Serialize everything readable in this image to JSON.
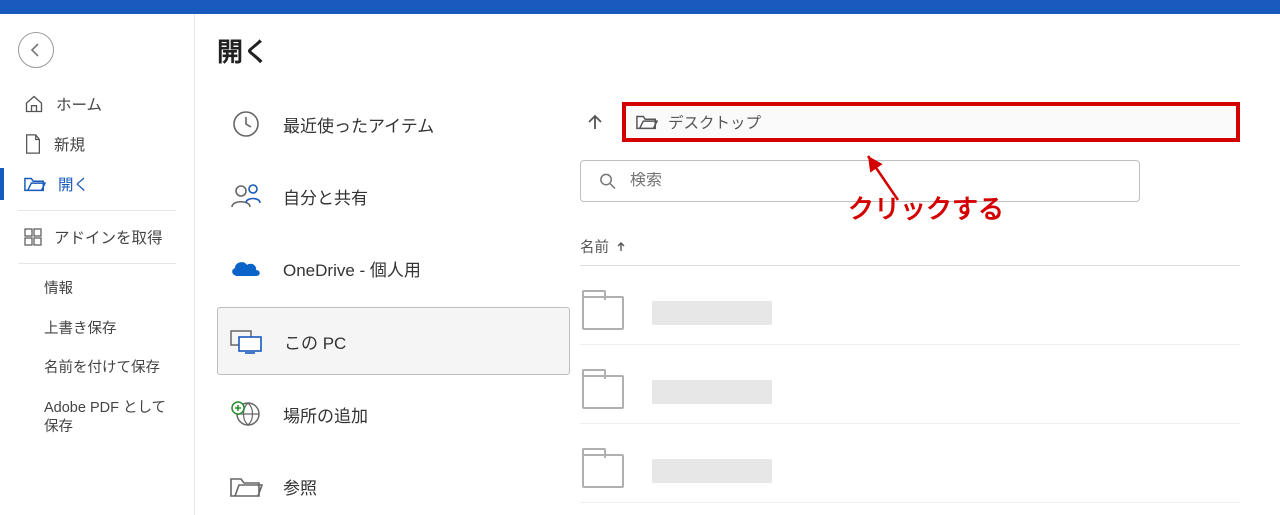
{
  "header": {
    "title": "開く"
  },
  "sidebar": {
    "items": [
      {
        "label": "ホーム",
        "icon": "home-icon",
        "active": false
      },
      {
        "label": "新規",
        "icon": "new-icon",
        "active": false
      },
      {
        "label": "開く",
        "icon": "open-icon",
        "active": true
      },
      {
        "label": "アドインを取得",
        "icon": "addin-icon",
        "active": false
      }
    ],
    "sub_items": [
      {
        "label": "情報"
      },
      {
        "label": "上書き保存"
      },
      {
        "label": "名前を付けて保存"
      },
      {
        "label": "Adobe PDF として保存"
      }
    ]
  },
  "locations": {
    "items": [
      {
        "label": "最近使ったアイテム",
        "icon": "recent-icon",
        "selected": false
      },
      {
        "label": "自分と共有",
        "icon": "shared-icon",
        "selected": false
      },
      {
        "label": "OneDrive - 個人用",
        "icon": "onedrive-icon",
        "selected": false
      },
      {
        "label": "この PC",
        "icon": "thispc-icon",
        "selected": true
      },
      {
        "label": "場所の追加",
        "icon": "addplace-icon",
        "selected": false
      },
      {
        "label": "参照",
        "icon": "browse-icon",
        "selected": false
      }
    ]
  },
  "path_bar": {
    "current": "デスクトップ"
  },
  "search": {
    "placeholder": "検索"
  },
  "columns": {
    "name": "名前"
  },
  "annotation": {
    "text": "クリックする"
  }
}
